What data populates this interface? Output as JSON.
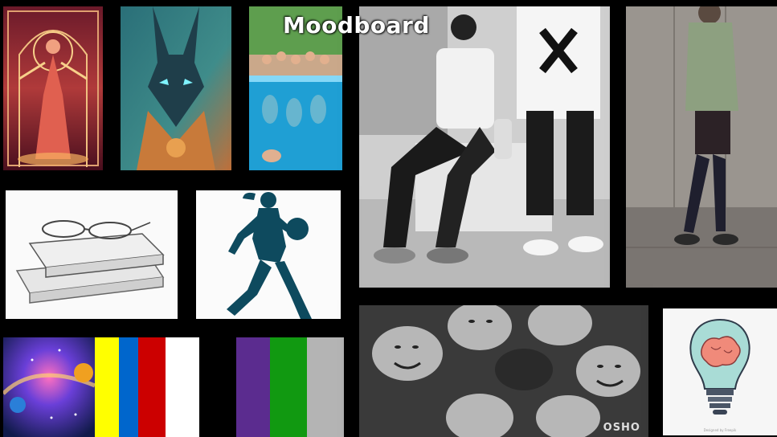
{
  "moodboard": {
    "title": "Moodboard",
    "palette_colors": [
      "#FFFF00",
      "#0066CC",
      "#CC0000",
      "#FFFFFF",
      "#000000",
      "#5B2C8F",
      "#119911",
      "#B4B4B4"
    ],
    "tiles": [
      {
        "name": "goddess-illustration",
        "icon": "goddess-illustration"
      },
      {
        "name": "anubis-illustration",
        "icon": "anubis-illustration"
      },
      {
        "name": "pool-friends-photo",
        "icon": "pool-photo"
      },
      {
        "name": "streetwear-duo-photo",
        "icon": "fashion-photo"
      },
      {
        "name": "green-hoodie-outfit-photo",
        "icon": "fashion-photo"
      },
      {
        "name": "books-glasses-sketch",
        "icon": "books-glasses-icon"
      },
      {
        "name": "basketball-player-silhouette",
        "icon": "basketball-player-icon"
      },
      {
        "name": "galaxy-image",
        "icon": "galaxy-icon"
      },
      {
        "name": "friends-circle-photo",
        "icon": "group-photo"
      },
      {
        "name": "lightbulb-brain-illustration",
        "icon": "lightbulb-brain-icon"
      }
    ],
    "group_photo_brand": "OSHO",
    "lightbulb_credit": "Designed by Freepik"
  }
}
